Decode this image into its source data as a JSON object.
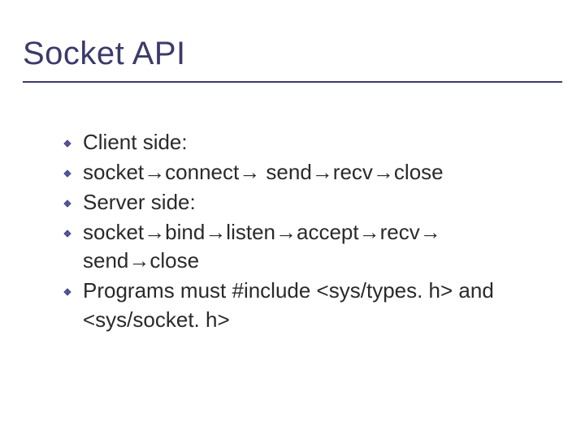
{
  "title": "Socket API",
  "bullets": [
    {
      "text": "Client side:"
    },
    {
      "text": "socket→connect→ send→recv→close"
    },
    {
      "text": "Server side:"
    },
    {
      "text": "socket→bind→listen→accept→recv→ send→close"
    },
    {
      "text": "Programs must #include <sys/types. h> and <sys/socket. h>"
    }
  ]
}
